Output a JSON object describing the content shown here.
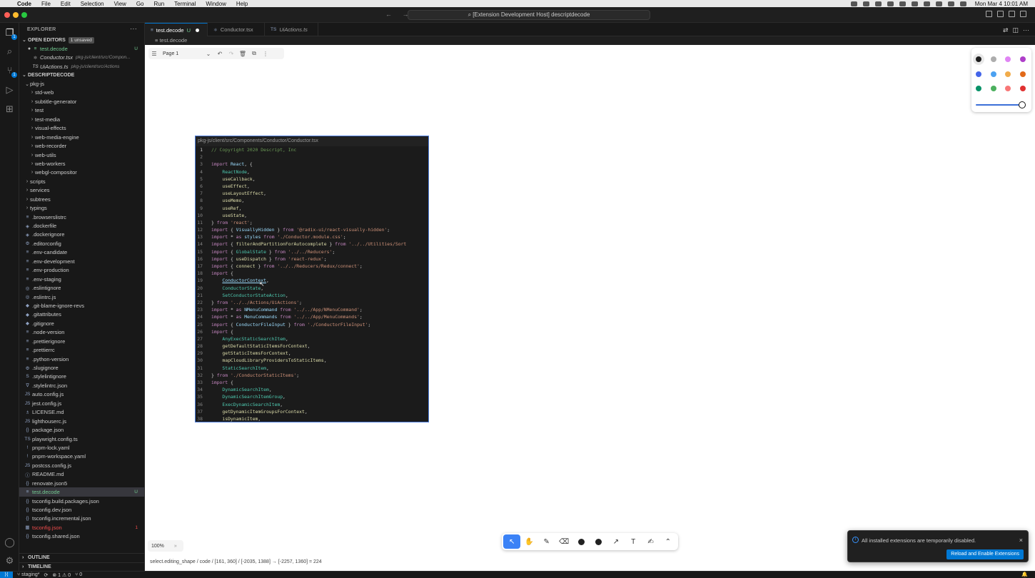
{
  "menubar": {
    "app": "Code",
    "items": [
      "File",
      "Edit",
      "Selection",
      "View",
      "Go",
      "Run",
      "Terminal",
      "Window",
      "Help"
    ],
    "clock": "Mon Mar 4  10:01 AM"
  },
  "titlebar": {
    "title": "[Extension Development Host] descriptdecode",
    "traffic_colors": [
      "#ff5f57",
      "#febc2e",
      "#28c840"
    ]
  },
  "activity": {
    "scm_badge": "1",
    "explorer_badge": "1"
  },
  "sidebar": {
    "header": "EXPLORER",
    "open_editors_label": "OPEN EDITORS",
    "unsaved_label": "1 unsaved",
    "open_editors": [
      {
        "name": "test.decode",
        "icon": "≡",
        "status": "U",
        "dirty": true
      },
      {
        "name": "Conductor.tsx",
        "icon": "⚛",
        "desc": "pkg-js/client/src/Compon..."
      },
      {
        "name": "UiActions.ts",
        "icon": "TS",
        "desc": "pkg-js/client/src/Actions"
      }
    ],
    "root_label": "DESCRIPTDECODE",
    "tree": [
      {
        "name": "pkg-js",
        "type": "open",
        "indent": 1
      },
      {
        "name": "std-web",
        "type": "folder",
        "indent": 2
      },
      {
        "name": "subtitle-generator",
        "type": "folder",
        "indent": 2
      },
      {
        "name": "test",
        "type": "folder",
        "indent": 2
      },
      {
        "name": "test-media",
        "type": "folder",
        "indent": 2
      },
      {
        "name": "visual-effects",
        "type": "folder",
        "indent": 2
      },
      {
        "name": "web-media-engine",
        "type": "folder",
        "indent": 2
      },
      {
        "name": "web-recorder",
        "type": "folder",
        "indent": 2
      },
      {
        "name": "web-utils",
        "type": "folder",
        "indent": 2
      },
      {
        "name": "web-workers",
        "type": "folder",
        "indent": 2
      },
      {
        "name": "webgl-compositor",
        "type": "folder",
        "indent": 2
      },
      {
        "name": "scripts",
        "type": "folder",
        "indent": 1
      },
      {
        "name": "services",
        "type": "folder",
        "indent": 1
      },
      {
        "name": "subtrees",
        "type": "folder",
        "indent": 1
      },
      {
        "name": "typings",
        "type": "folder",
        "indent": 1
      },
      {
        "name": ".browserslistrc",
        "type": "file",
        "icon": "≡",
        "indent": 1
      },
      {
        "name": ".dockerfile",
        "type": "file",
        "icon": "◈",
        "indent": 1
      },
      {
        "name": ".dockerignore",
        "type": "file",
        "icon": "◈",
        "indent": 1
      },
      {
        "name": ".editorconfig",
        "type": "file",
        "icon": "⚙",
        "indent": 1
      },
      {
        "name": ".env-candidate",
        "type": "file",
        "icon": "≡",
        "indent": 1
      },
      {
        "name": ".env-development",
        "type": "file",
        "icon": "≡",
        "indent": 1
      },
      {
        "name": ".env-production",
        "type": "file",
        "icon": "≡",
        "indent": 1
      },
      {
        "name": ".env-staging",
        "type": "file",
        "icon": "≡",
        "indent": 1
      },
      {
        "name": ".eslintignore",
        "type": "file",
        "icon": "◎",
        "indent": 1
      },
      {
        "name": ".eslintrc.js",
        "type": "file",
        "icon": "◎",
        "indent": 1
      },
      {
        "name": ".git-blame-ignore-revs",
        "type": "file",
        "icon": "◆",
        "indent": 1
      },
      {
        "name": ".gitattributes",
        "type": "file",
        "icon": "◆",
        "indent": 1
      },
      {
        "name": ".gitignore",
        "type": "file",
        "icon": "◆",
        "indent": 1
      },
      {
        "name": ".node-version",
        "type": "file",
        "icon": "≡",
        "indent": 1
      },
      {
        "name": ".prettierignore",
        "type": "file",
        "icon": "≡",
        "indent": 1
      },
      {
        "name": ".prettierrc",
        "type": "file",
        "icon": "≡",
        "indent": 1
      },
      {
        "name": ".python-version",
        "type": "file",
        "icon": "≡",
        "indent": 1
      },
      {
        "name": ".slugignore",
        "type": "file",
        "icon": "⚙",
        "indent": 1
      },
      {
        "name": ".stylelintignore",
        "type": "file",
        "icon": "S",
        "indent": 1
      },
      {
        "name": ".stylelintrc.json",
        "type": "file",
        "icon": "∇",
        "indent": 1
      },
      {
        "name": "auto.config.js",
        "type": "file",
        "icon": "JS",
        "indent": 1
      },
      {
        "name": "jest.config.js",
        "type": "file",
        "icon": "JS",
        "indent": 1
      },
      {
        "name": "LICENSE.md",
        "type": "file",
        "icon": "♗",
        "indent": 1
      },
      {
        "name": "lighthouserc.js",
        "type": "file",
        "icon": "JS",
        "indent": 1
      },
      {
        "name": "package.json",
        "type": "file",
        "icon": "{}",
        "indent": 1
      },
      {
        "name": "playwright.config.ts",
        "type": "file",
        "icon": "TS",
        "indent": 1
      },
      {
        "name": "pnpm-lock.yaml",
        "type": "file",
        "icon": "!",
        "indent": 1
      },
      {
        "name": "pnpm-workspace.yaml",
        "type": "file",
        "icon": "!",
        "indent": 1
      },
      {
        "name": "postcss.config.js",
        "type": "file",
        "icon": "JS",
        "indent": 1
      },
      {
        "name": "README.md",
        "type": "file",
        "icon": "ⓘ",
        "indent": 1
      },
      {
        "name": "renovate.json5",
        "type": "file",
        "icon": "{}",
        "indent": 1
      },
      {
        "name": "test.decode",
        "type": "file",
        "icon": "≡",
        "indent": 1,
        "status": "U",
        "selected": true
      },
      {
        "name": "tsconfig.build.packages.json",
        "type": "file",
        "icon": "{}",
        "indent": 1
      },
      {
        "name": "tsconfig.dev.json",
        "type": "file",
        "icon": "{}",
        "indent": 1
      },
      {
        "name": "tsconfig.incremental.json",
        "type": "file",
        "icon": "{}",
        "indent": 1
      },
      {
        "name": "tsconfig.json",
        "type": "file",
        "icon": "▦",
        "indent": 1,
        "status": "1",
        "error": true
      },
      {
        "name": "tsconfig.shared.json",
        "type": "file",
        "icon": "{}",
        "indent": 1
      }
    ],
    "outline_label": "OUTLINE",
    "timeline_label": "TIMELINE"
  },
  "tabs": [
    {
      "label": "test.decode",
      "icon": "≡",
      "suffix": "U",
      "active": true,
      "dirty": true
    },
    {
      "label": "Conductor.tsx",
      "icon": "⚛",
      "active": false
    },
    {
      "label": "UiActions.ts",
      "icon": "TS",
      "active": false,
      "italic": true
    }
  ],
  "breadcrumb": "test.decode",
  "page_toolbar": {
    "page_label": "Page 1"
  },
  "style_panel": {
    "colors": [
      [
        "#1d1d1d",
        "#adadad",
        "#e085f4",
        "#ae3ec9"
      ],
      [
        "#4465e9",
        "#4ba1f1",
        "#f1ac4b",
        "#e16919"
      ],
      [
        "#099268",
        "#4cb05e",
        "#f87777",
        "#e03131"
      ]
    ],
    "selected_color": "#1d1d1d",
    "opacity_value": 1.0
  },
  "code_shape": {
    "title": "pkg-js/client/src/Components/Conductor/Conductor.tsx",
    "current_line": 1,
    "lines": [
      [
        {
          "c": "cm",
          "t": "// Copyright 2020 Descript, Inc"
        }
      ],
      [],
      [
        {
          "c": "kw2",
          "t": "import"
        },
        {
          "c": "ct",
          "t": " "
        },
        {
          "c": "id",
          "t": "React"
        },
        {
          "c": "ct",
          "t": ", {"
        }
      ],
      [
        {
          "c": "ct",
          "t": "    "
        },
        {
          "c": "ty",
          "t": "ReactNode"
        },
        {
          "c": "ct",
          "t": ","
        }
      ],
      [
        {
          "c": "ct",
          "t": "    "
        },
        {
          "c": "fn",
          "t": "useCallback"
        },
        {
          "c": "ct",
          "t": ","
        }
      ],
      [
        {
          "c": "ct",
          "t": "    "
        },
        {
          "c": "fn",
          "t": "useEffect"
        },
        {
          "c": "ct",
          "t": ","
        }
      ],
      [
        {
          "c": "ct",
          "t": "    "
        },
        {
          "c": "fn",
          "t": "useLayoutEffect"
        },
        {
          "c": "ct",
          "t": ","
        }
      ],
      [
        {
          "c": "ct",
          "t": "    "
        },
        {
          "c": "fn",
          "t": "useMemo"
        },
        {
          "c": "ct",
          "t": ","
        }
      ],
      [
        {
          "c": "ct",
          "t": "    "
        },
        {
          "c": "fn",
          "t": "useRef"
        },
        {
          "c": "ct",
          "t": ","
        }
      ],
      [
        {
          "c": "ct",
          "t": "    "
        },
        {
          "c": "fn",
          "t": "useState"
        },
        {
          "c": "ct",
          "t": ","
        }
      ],
      [
        {
          "c": "ct",
          "t": "} "
        },
        {
          "c": "kw2",
          "t": "from"
        },
        {
          "c": "ct",
          "t": " "
        },
        {
          "c": "str",
          "t": "'react'"
        },
        {
          "c": "ct",
          "t": ";"
        }
      ],
      [
        {
          "c": "kw2",
          "t": "import"
        },
        {
          "c": "ct",
          "t": " { "
        },
        {
          "c": "id",
          "t": "VisuallyHidden"
        },
        {
          "c": "ct",
          "t": " } "
        },
        {
          "c": "kw2",
          "t": "from"
        },
        {
          "c": "ct",
          "t": " "
        },
        {
          "c": "str",
          "t": "'@radix-ui/react-visually-hidden'"
        },
        {
          "c": "ct",
          "t": ";"
        }
      ],
      [
        {
          "c": "kw2",
          "t": "import"
        },
        {
          "c": "ct",
          "t": " * "
        },
        {
          "c": "kw2",
          "t": "as"
        },
        {
          "c": "ct",
          "t": " "
        },
        {
          "c": "id",
          "t": "styles"
        },
        {
          "c": "ct",
          "t": " "
        },
        {
          "c": "kw2",
          "t": "from"
        },
        {
          "c": "ct",
          "t": " "
        },
        {
          "c": "str",
          "t": "'./Conductor.module.css'"
        },
        {
          "c": "ct",
          "t": ";"
        }
      ],
      [
        {
          "c": "kw2",
          "t": "import"
        },
        {
          "c": "ct",
          "t": " { "
        },
        {
          "c": "fn",
          "t": "filterAndPartitionForAutocomplete"
        },
        {
          "c": "ct",
          "t": " } "
        },
        {
          "c": "kw2",
          "t": "from"
        },
        {
          "c": "ct",
          "t": " "
        },
        {
          "c": "str",
          "t": "'../../Utilities/Sort"
        }
      ],
      [
        {
          "c": "kw2",
          "t": "import"
        },
        {
          "c": "ct",
          "t": " { "
        },
        {
          "c": "ty",
          "t": "GlobalState"
        },
        {
          "c": "ct",
          "t": " } "
        },
        {
          "c": "kw2",
          "t": "from"
        },
        {
          "c": "ct",
          "t": " "
        },
        {
          "c": "str",
          "t": "'../../Reducers'"
        },
        {
          "c": "ct",
          "t": ";"
        }
      ],
      [
        {
          "c": "kw2",
          "t": "import"
        },
        {
          "c": "ct",
          "t": " { "
        },
        {
          "c": "fn",
          "t": "useDispatch"
        },
        {
          "c": "ct",
          "t": " } "
        },
        {
          "c": "kw2",
          "t": "from"
        },
        {
          "c": "ct",
          "t": " "
        },
        {
          "c": "str",
          "t": "'react-redux'"
        },
        {
          "c": "ct",
          "t": ";"
        }
      ],
      [
        {
          "c": "kw2",
          "t": "import"
        },
        {
          "c": "ct",
          "t": " { "
        },
        {
          "c": "fn",
          "t": "connect"
        },
        {
          "c": "ct",
          "t": " } "
        },
        {
          "c": "kw2",
          "t": "from"
        },
        {
          "c": "ct",
          "t": " "
        },
        {
          "c": "str",
          "t": "'../../Reducers/Redux/connect'"
        },
        {
          "c": "ct",
          "t": ";"
        }
      ],
      [
        {
          "c": "kw2",
          "t": "import"
        },
        {
          "c": "ct",
          "t": " {"
        }
      ],
      [
        {
          "c": "ct",
          "t": "    "
        },
        {
          "c": "id ul",
          "t": "ConductorContext"
        },
        {
          "c": "ct",
          "t": ","
        }
      ],
      [
        {
          "c": "ct",
          "t": "    "
        },
        {
          "c": "ty",
          "t": "ConductorState"
        },
        {
          "c": "ct",
          "t": ","
        }
      ],
      [
        {
          "c": "ct",
          "t": "    "
        },
        {
          "c": "ty",
          "t": "SetConductorStateAction"
        },
        {
          "c": "ct",
          "t": ","
        }
      ],
      [
        {
          "c": "ct",
          "t": "} "
        },
        {
          "c": "kw2",
          "t": "from"
        },
        {
          "c": "ct",
          "t": " "
        },
        {
          "c": "str",
          "t": "'../../Actions/UiActions'"
        },
        {
          "c": "ct",
          "t": ";"
        }
      ],
      [
        {
          "c": "kw2",
          "t": "import"
        },
        {
          "c": "ct",
          "t": " * "
        },
        {
          "c": "kw2",
          "t": "as"
        },
        {
          "c": "ct",
          "t": " "
        },
        {
          "c": "id",
          "t": "NMenuCommand"
        },
        {
          "c": "ct",
          "t": " "
        },
        {
          "c": "kw2",
          "t": "from"
        },
        {
          "c": "ct",
          "t": " "
        },
        {
          "c": "str",
          "t": "'../../App/NMenuCommand'"
        },
        {
          "c": "ct",
          "t": ";"
        }
      ],
      [
        {
          "c": "kw2",
          "t": "import"
        },
        {
          "c": "ct",
          "t": " * "
        },
        {
          "c": "kw2",
          "t": "as"
        },
        {
          "c": "ct",
          "t": " "
        },
        {
          "c": "id",
          "t": "MenuCommands"
        },
        {
          "c": "ct",
          "t": " "
        },
        {
          "c": "kw2",
          "t": "from"
        },
        {
          "c": "ct",
          "t": " "
        },
        {
          "c": "str",
          "t": "'../../App/MenuCommands'"
        },
        {
          "c": "ct",
          "t": ";"
        }
      ],
      [
        {
          "c": "kw2",
          "t": "import"
        },
        {
          "c": "ct",
          "t": " { "
        },
        {
          "c": "id",
          "t": "ConductorFileInput"
        },
        {
          "c": "ct",
          "t": " } "
        },
        {
          "c": "kw2",
          "t": "from"
        },
        {
          "c": "ct",
          "t": " "
        },
        {
          "c": "str",
          "t": "'./ConductorFileInput'"
        },
        {
          "c": "ct",
          "t": ";"
        }
      ],
      [
        {
          "c": "kw2",
          "t": "import"
        },
        {
          "c": "ct",
          "t": " {"
        }
      ],
      [
        {
          "c": "ct",
          "t": "    "
        },
        {
          "c": "ty",
          "t": "AnyExecStaticSearchItem"
        },
        {
          "c": "ct",
          "t": ","
        }
      ],
      [
        {
          "c": "ct",
          "t": "    "
        },
        {
          "c": "fn",
          "t": "getDefaultStaticItemsForContext"
        },
        {
          "c": "ct",
          "t": ","
        }
      ],
      [
        {
          "c": "ct",
          "t": "    "
        },
        {
          "c": "fn",
          "t": "getStaticItemsForContext"
        },
        {
          "c": "ct",
          "t": ","
        }
      ],
      [
        {
          "c": "ct",
          "t": "    "
        },
        {
          "c": "fn",
          "t": "mapCloudLibraryProvidersToStaticItems"
        },
        {
          "c": "ct",
          "t": ","
        }
      ],
      [
        {
          "c": "ct",
          "t": "    "
        },
        {
          "c": "ty",
          "t": "StaticSearchItem"
        },
        {
          "c": "ct",
          "t": ","
        }
      ],
      [
        {
          "c": "ct",
          "t": "} "
        },
        {
          "c": "kw2",
          "t": "from"
        },
        {
          "c": "ct",
          "t": " "
        },
        {
          "c": "str",
          "t": "'./ConductorStaticItems'"
        },
        {
          "c": "ct",
          "t": ";"
        }
      ],
      [
        {
          "c": "kw2",
          "t": "import"
        },
        {
          "c": "ct",
          "t": " {"
        }
      ],
      [
        {
          "c": "ct",
          "t": "    "
        },
        {
          "c": "ty",
          "t": "DynamicSearchItem"
        },
        {
          "c": "ct",
          "t": ","
        }
      ],
      [
        {
          "c": "ct",
          "t": "    "
        },
        {
          "c": "ty",
          "t": "DynamicSearchItemGroup"
        },
        {
          "c": "ct",
          "t": ","
        }
      ],
      [
        {
          "c": "ct",
          "t": "    "
        },
        {
          "c": "ty",
          "t": "ExecDynamicSearchItem"
        },
        {
          "c": "ct",
          "t": ","
        }
      ],
      [
        {
          "c": "ct",
          "t": "    "
        },
        {
          "c": "fn",
          "t": "getDynamicItemGroupsForContext"
        },
        {
          "c": "ct",
          "t": ","
        }
      ],
      [
        {
          "c": "ct",
          "t": "    "
        },
        {
          "c": "fn",
          "t": "isDynamicItem"
        },
        {
          "c": "ct",
          "t": ","
        }
      ]
    ]
  },
  "zoom": {
    "label": "100%"
  },
  "debug_line": "select.editing_shape / code / [161, 360] / [-2035, 1388] → [-2257, 1360] = 224",
  "notification": {
    "message": "All installed extensions are temporarily disabled.",
    "button": "Reload and Enable Extensions"
  },
  "statusbar": {
    "branch": "staging*",
    "problems": "⊗ 1 ⚠ 0",
    "ports": "⑂ 0"
  }
}
